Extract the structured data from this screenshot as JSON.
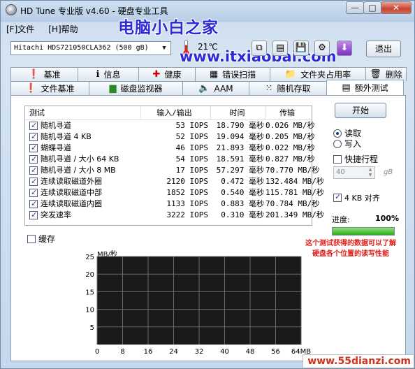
{
  "window": {
    "title": "HD Tune 专业版 v4.60 - 硬盘专业工具",
    "minimize": "—",
    "maximize": "□",
    "close": "✕"
  },
  "watermarks": {
    "site_name": "电脑小白之家",
    "site_url": "www.itxiaobai.com",
    "bottom_url": "www.55dianzi.com"
  },
  "menu": {
    "file": "[F]文件",
    "help": "[H]帮助"
  },
  "toolbar": {
    "drive": "Hitachi HDS721050CLA362 (500 gB)",
    "temperature": "21℃",
    "exit": "退出",
    "icons": [
      "copy-icon",
      "copy-screenshot-icon",
      "save-icon",
      "options-icon",
      "download-icon"
    ]
  },
  "tabs_top": [
    {
      "label": "基准",
      "icon": "exclamation-icon"
    },
    {
      "label": "信息",
      "icon": "info-icon"
    },
    {
      "label": "健康",
      "icon": "health-cross-icon"
    },
    {
      "label": "错误扫描",
      "icon": "scan-icon"
    },
    {
      "label": "文件夹占用率",
      "icon": "folder-icon"
    },
    {
      "label": "删除",
      "icon": "trash-icon"
    }
  ],
  "tabs_bottom": [
    {
      "label": "文件基准",
      "icon": "file-benchmark-icon"
    },
    {
      "label": "磁盘监视器",
      "icon": "chart-icon"
    },
    {
      "label": "AAM",
      "icon": "speaker-icon"
    },
    {
      "label": "随机存取",
      "icon": "random-access-icon"
    },
    {
      "label": "额外测试",
      "icon": "extra-tests-icon",
      "active": true
    }
  ],
  "table": {
    "headers": [
      "测试",
      "输入/输出",
      "时间",
      "传输"
    ],
    "rows": [
      {
        "name": "随机寻道",
        "io": "53 IOPS",
        "time": "18.790 毫秒",
        "transfer": "0.026 MB/秒",
        "checked": true
      },
      {
        "name": "随机寻道 4 KB",
        "io": "52 IOPS",
        "time": "19.094 毫秒",
        "transfer": "0.205 MB/秒",
        "checked": true
      },
      {
        "name": "蝴蝶寻道",
        "io": "46 IOPS",
        "time": "21.893 毫秒",
        "transfer": "0.022 MB/秒",
        "checked": true
      },
      {
        "name": "随机寻道 / 大小 64 KB",
        "io": "54 IOPS",
        "time": "18.591 毫秒",
        "transfer": "0.827 MB/秒",
        "checked": true
      },
      {
        "name": "随机寻道 / 大小 8 MB",
        "io": "17 IOPS",
        "time": "57.297 毫秒",
        "transfer": "70.770 MB/秒",
        "checked": true
      },
      {
        "name": "连续读取磁道外圈",
        "io": "2120 IOPS",
        "time": "0.472 毫秒",
        "transfer": "132.484 MB/秒",
        "checked": true
      },
      {
        "name": "连续读取磁道中部",
        "io": "1852 IOPS",
        "time": "0.540 毫秒",
        "transfer": "115.781 MB/秒",
        "checked": true
      },
      {
        "name": "连续读取磁道内圈",
        "io": "1133 IOPS",
        "time": "0.883 毫秒",
        "transfer": "70.784 MB/秒",
        "checked": true
      },
      {
        "name": "突发速率",
        "io": "3222 IOPS",
        "time": "0.310 毫秒",
        "transfer": "201.349 MB/秒",
        "checked": true
      }
    ]
  },
  "cache": {
    "label": "缓存",
    "checked": false
  },
  "controls": {
    "start": "开始",
    "read": "读取",
    "write": "写入",
    "mode": "read",
    "quick_label": "快捷行程",
    "quick_checked": false,
    "quick_value": "40",
    "quick_unit": "gB",
    "align_label": "4 KB 对齐",
    "align_checked": true,
    "progress_label": "进度:",
    "progress_text": "100%",
    "progress_value": 1.0
  },
  "annotation": "这个测试获得的数据可以了解硬盘各个位置的读写性能",
  "chart_data": {
    "type": "line",
    "ylabel": "MB/秒",
    "ylim": [
      0,
      25
    ],
    "yticks": [
      "25",
      "20",
      "15",
      "10",
      "5"
    ],
    "xlim": [
      0,
      64
    ],
    "xticks": [
      "0",
      "8",
      "16",
      "24",
      "32",
      "40",
      "48",
      "56",
      "64MB"
    ],
    "grid": true,
    "background": "#1a1a1a",
    "grid_color": "#6b6b6b",
    "series": []
  }
}
